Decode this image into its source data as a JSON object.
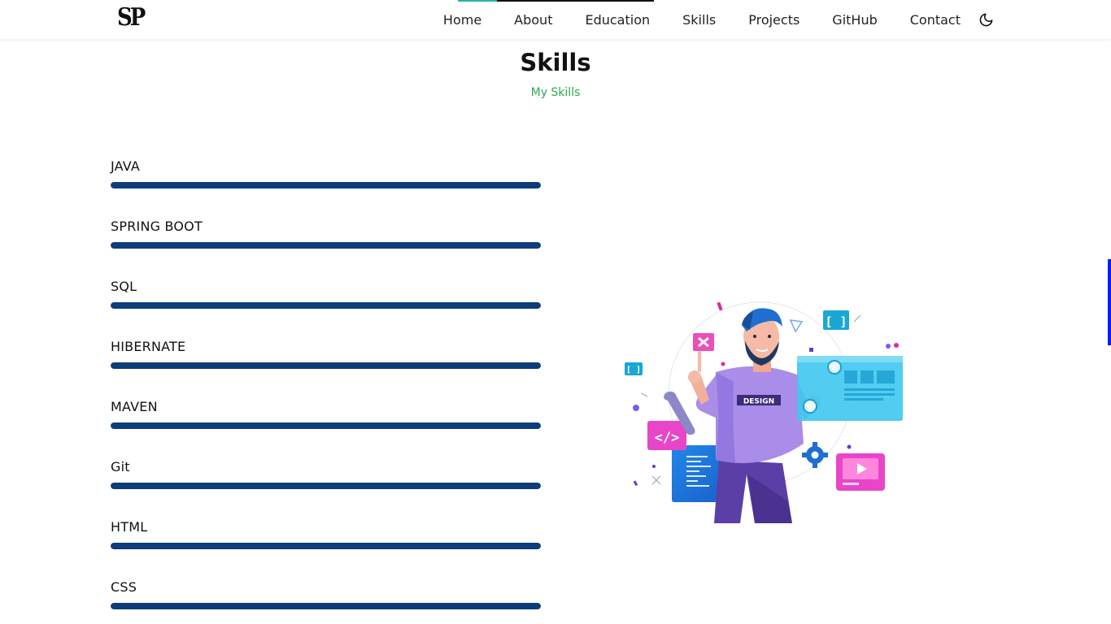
{
  "header": {
    "logo": "SP",
    "nav": [
      "Home",
      "About",
      "Education",
      "Skills",
      "Projects",
      "GitHub",
      "Contact"
    ],
    "theme_icon": "moon-icon"
  },
  "section": {
    "title": "Skills",
    "subtitle": "My Skills"
  },
  "skills": [
    {
      "name": "JAVA",
      "level": 1.0
    },
    {
      "name": "SPRING BOOT",
      "level": 1.0
    },
    {
      "name": "SQL",
      "level": 1.0
    },
    {
      "name": "HIBERNATE",
      "level": 1.0
    },
    {
      "name": "MAVEN",
      "level": 1.0
    },
    {
      "name": "Git",
      "level": 1.0
    },
    {
      "name": "HTML",
      "level": 1.0
    },
    {
      "name": "CSS",
      "level": 1.0
    }
  ],
  "illustration": {
    "badge_text": "DESIGN"
  },
  "colors": {
    "accent_green": "#2fa84f",
    "skill_bar": "#0d3d7a",
    "scroll_marker": "#0a1cff"
  }
}
